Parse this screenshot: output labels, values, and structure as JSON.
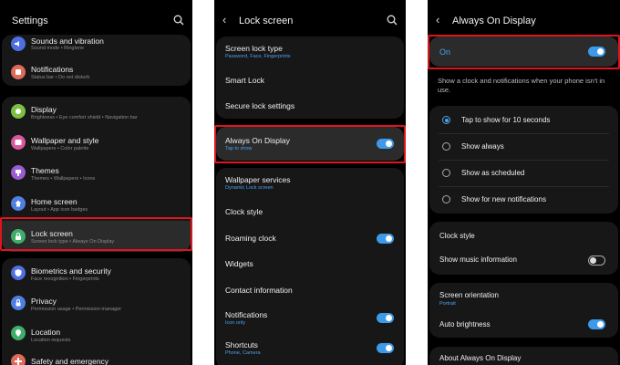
{
  "settings": {
    "title": "Settings",
    "items": [
      {
        "label": "Sounds and vibration",
        "sub": "Sound mode  •  Ringtone",
        "color": "#4f6fe0"
      },
      {
        "label": "Notifications",
        "sub": "Status bar  •  Do not disturb",
        "color": "#e06a5a"
      },
      {
        "label": "Display",
        "sub": "Brightness  •  Eye comfort shield  •  Navigation bar",
        "color": "#7cc043"
      },
      {
        "label": "Wallpaper and style",
        "sub": "Wallpapers  •  Color palette",
        "color": "#d9579c"
      },
      {
        "label": "Themes",
        "sub": "Themes  •  Wallpapers  •  Icons",
        "color": "#9b5bd1"
      },
      {
        "label": "Home screen",
        "sub": "Layout  •  App icon badges",
        "color": "#4f7fe0"
      },
      {
        "label": "Lock screen",
        "sub": "Screen lock type  •  Always On Display",
        "color": "#3fae6a"
      },
      {
        "label": "Biometrics and security",
        "sub": "Face recognition  •  Fingerprints",
        "color": "#4f6fe0"
      },
      {
        "label": "Privacy",
        "sub": "Permission usage  •  Permission manager",
        "color": "#4f7fe0"
      },
      {
        "label": "Location",
        "sub": "Location requests",
        "color": "#3fae6a"
      },
      {
        "label": "Safety and emergency",
        "sub": "",
        "color": "#e06a5a"
      }
    ]
  },
  "lock": {
    "title": "Lock screen",
    "items": [
      {
        "label": "Screen lock type",
        "sub": "Password, Face, Fingerprints"
      },
      {
        "label": "Smart Lock",
        "sub": ""
      },
      {
        "label": "Secure lock settings",
        "sub": ""
      },
      {
        "label": "Always On Display",
        "sub": "Tap to show"
      },
      {
        "label": "Wallpaper services",
        "sub": "Dynamic Lock screen"
      },
      {
        "label": "Clock style",
        "sub": ""
      },
      {
        "label": "Roaming clock",
        "sub": ""
      },
      {
        "label": "Widgets",
        "sub": ""
      },
      {
        "label": "Contact information",
        "sub": ""
      },
      {
        "label": "Notifications",
        "sub": "Icon only"
      },
      {
        "label": "Shortcuts",
        "sub": "Phone, Camera"
      }
    ]
  },
  "aod": {
    "title": "Always On Display",
    "on_label": "On",
    "description": "Show a clock and notifications when your phone isn't in use.",
    "options": [
      {
        "label": "Tap to show for 10 seconds"
      },
      {
        "label": "Show always"
      },
      {
        "label": "Show as scheduled"
      },
      {
        "label": "Show for new notifications"
      }
    ],
    "clock_style": "Clock style",
    "music": "Show music information",
    "orientation": {
      "label": "Screen orientation",
      "sub": "Portrait"
    },
    "auto_brightness": "Auto brightness",
    "about": "About Always On Display"
  },
  "colors": {
    "accent": "#3e9ae9",
    "highlight": "#e0141e"
  }
}
